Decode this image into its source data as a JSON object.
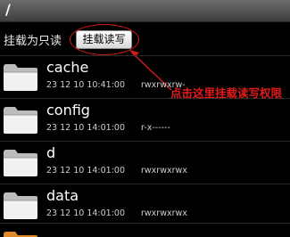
{
  "titlebar": {
    "path": "/"
  },
  "mount": {
    "status_label": "挂载为只读",
    "button_label": "挂载读写"
  },
  "annotation": {
    "text": "点击这里挂载读写权限",
    "color": "#e31a1a"
  },
  "files": [
    {
      "name": "cache",
      "date": "23 12 10 10:41:00",
      "perm": "rwxrwxrw-",
      "icon": "folder-icon"
    },
    {
      "name": "config",
      "date": "23 12 10 14:01:00",
      "perm": "r-x------",
      "icon": "folder-icon"
    },
    {
      "name": "d",
      "date": "23 12 10 14:01:00",
      "perm": "rwxrwxrwx",
      "icon": "folder-icon"
    },
    {
      "name": "data",
      "date": "23 12 10 14:01:00",
      "perm": "rwxrwxrwx",
      "icon": "folder-icon"
    }
  ],
  "colors": {
    "background": "#000000",
    "highlight": "#d51b1b"
  }
}
